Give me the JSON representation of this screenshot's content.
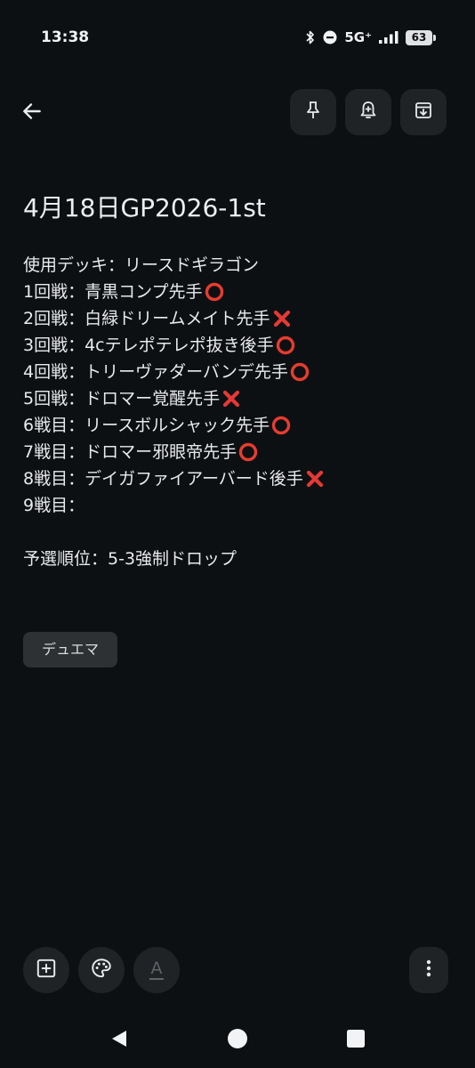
{
  "status_bar": {
    "time": "13:38",
    "network": "5G⁺",
    "battery": "63",
    "icons": [
      "bluetooth-icon",
      "do-not-disturb-icon",
      "signal-icon",
      "battery-icon"
    ]
  },
  "toolbar": {
    "back_icon": "arrow-left-icon",
    "actions": [
      "pin-icon",
      "reminder-bell-icon",
      "archive-icon"
    ]
  },
  "note": {
    "title": "4月18日GP2026-1st",
    "lines": [
      {
        "text": "使用デッキ：リースドギラゴン",
        "mark": ""
      },
      {
        "text": "1回戦：青黒コンプ先手",
        "mark": "circle"
      },
      {
        "text": "2回戦：白緑ドリームメイト先手",
        "mark": "cross"
      },
      {
        "text": "3回戦：4cテレポテレポ抜き後手",
        "mark": "circle"
      },
      {
        "text": "4回戦：トリーヴァダーバンデ先手",
        "mark": "circle"
      },
      {
        "text": "5回戦：ドロマー覚醒先手",
        "mark": "cross"
      },
      {
        "text": "6戦目：リースボルシャック先手",
        "mark": "circle"
      },
      {
        "text": "7戦目：ドロマー邪眼帝先手",
        "mark": "circle"
      },
      {
        "text": "8戦目：デイガファイアーバード後手",
        "mark": "cross"
      },
      {
        "text": "9戦目：",
        "mark": ""
      }
    ],
    "result": "予選順位：5-3強制ドロップ",
    "label": "デュエマ"
  },
  "bottom_bar": {
    "icons": [
      "add-box-icon",
      "palette-icon",
      "text-format-icon",
      "more-vertical-icon"
    ],
    "text_format_glyph": "A"
  },
  "nav_bar": {
    "icons": [
      "back-triangle-icon",
      "home-circle-icon",
      "recents-square-icon"
    ]
  },
  "colors": {
    "background": "#0d1013",
    "button_bg": "#1f2326",
    "chip_bg": "#2d3134",
    "circle_mark": "#e63c2f",
    "cross_mark": "#e53935"
  }
}
